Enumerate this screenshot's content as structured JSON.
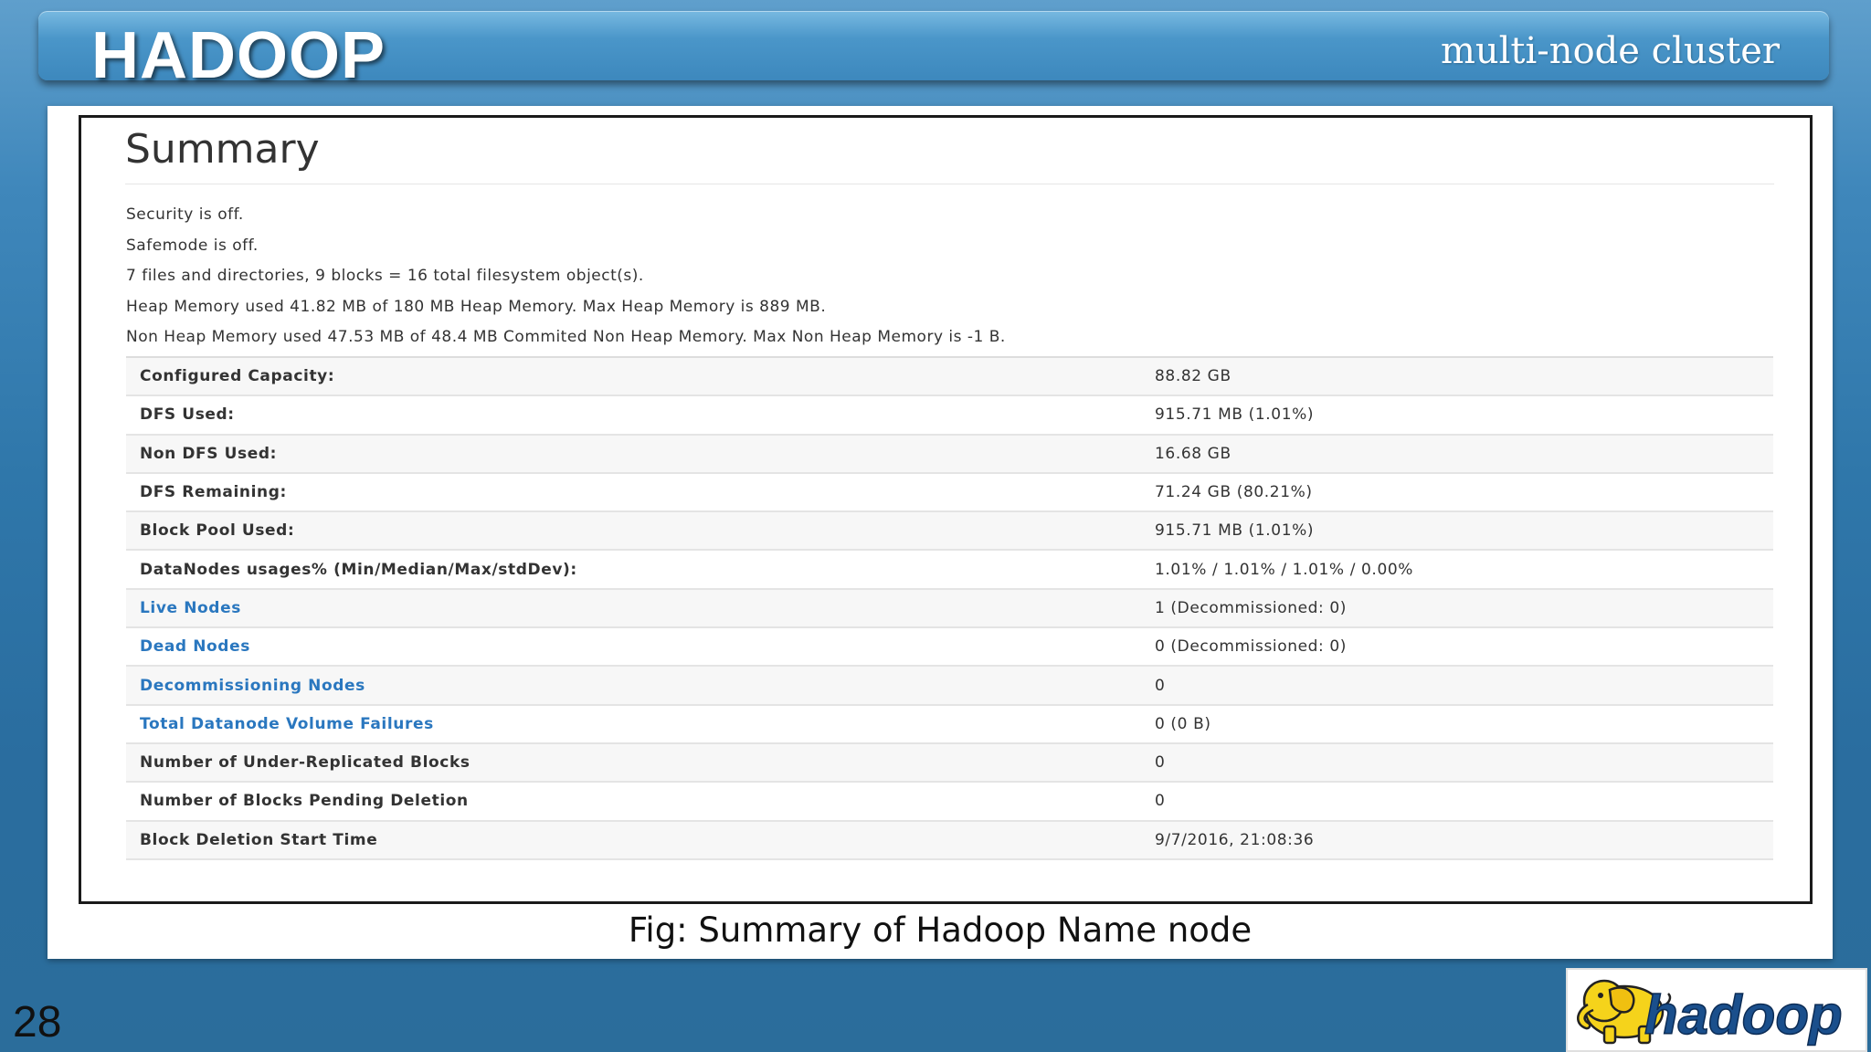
{
  "banner": {
    "title": "HADOOP",
    "subtitle": "multi-node cluster"
  },
  "summary": {
    "title": "Summary",
    "info_lines": [
      "Security is off.",
      "Safemode is off.",
      "7 files and directories, 9 blocks = 16 total filesystem object(s).",
      "Heap Memory used 41.82 MB of 180 MB Heap Memory. Max Heap Memory is 889 MB.",
      "Non Heap Memory used 47.53 MB of 48.4 MB Commited Non Heap Memory. Max Non Heap Memory is -1 B."
    ],
    "rows": [
      {
        "label": "Configured Capacity:",
        "value": "88.82 GB",
        "is_link": false
      },
      {
        "label": "DFS Used:",
        "value": "915.71 MB (1.01%)",
        "is_link": false
      },
      {
        "label": "Non DFS Used:",
        "value": "16.68 GB",
        "is_link": false
      },
      {
        "label": "DFS Remaining:",
        "value": "71.24 GB (80.21%)",
        "is_link": false
      },
      {
        "label": "Block Pool Used:",
        "value": "915.71 MB (1.01%)",
        "is_link": false
      },
      {
        "label": "DataNodes usages% (Min/Median/Max/stdDev):",
        "value": "1.01% / 1.01% / 1.01% / 0.00%",
        "is_link": false
      },
      {
        "label": "Live Nodes",
        "value": "1 (Decommissioned: 0)",
        "is_link": true
      },
      {
        "label": "Dead Nodes",
        "value": "0 (Decommissioned: 0)",
        "is_link": true
      },
      {
        "label": "Decommissioning Nodes",
        "value": "0",
        "is_link": true
      },
      {
        "label": "Total Datanode Volume Failures",
        "value": "0 (0 B)",
        "is_link": true
      },
      {
        "label": "Number of Under-Replicated Blocks",
        "value": "0",
        "is_link": false
      },
      {
        "label": "Number of Blocks Pending Deletion",
        "value": "0",
        "is_link": false
      },
      {
        "label": "Block Deletion Start Time",
        "value": "9/7/2016, 21:08:36",
        "is_link": false
      }
    ]
  },
  "caption": "Fig: Summary of Hadoop Name node",
  "slide_number": "28",
  "logo": {
    "text": "hadoop",
    "icon": "yellow-elephant-icon"
  },
  "colors": {
    "link": "#2a77bf",
    "banner": "#4a96c9",
    "background": "#2f77aa",
    "logo_elephant": "#f5d31b",
    "logo_text": "#1a4f8c"
  }
}
